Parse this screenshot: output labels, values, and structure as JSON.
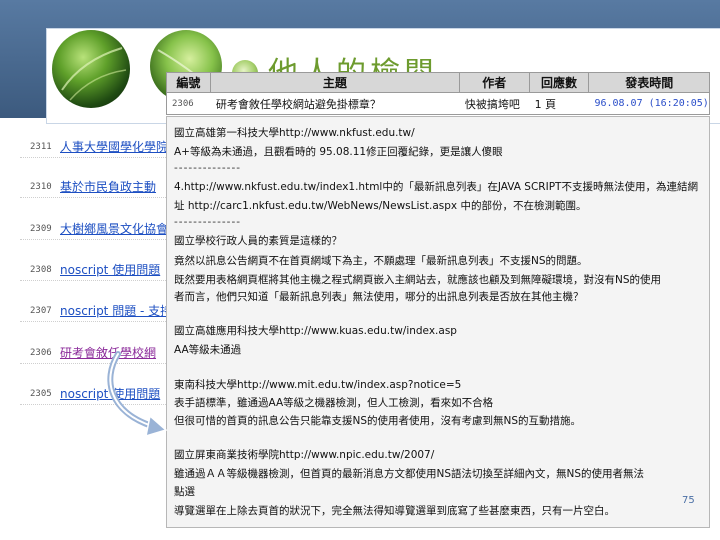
{
  "slide": {
    "title": "他人的檢閱",
    "page_number": "75"
  },
  "table": {
    "headers": [
      "編號",
      "主題",
      "作者",
      "回應數",
      "發表時間"
    ],
    "row": {
      "id": "2306",
      "subject": "研考會敘任學校網站避免掛標章？",
      "author": "快被搞垮吧",
      "replies": "1 頁",
      "time": "96.08.07 (16:20:05)"
    }
  },
  "background_list": [
    {
      "id": "2311",
      "title": "人事大學國學化學院",
      "visited": false
    },
    {
      "id": "2310",
      "title": "基於市民負政主動",
      "visited": false
    },
    {
      "id": "2309",
      "title": "大樹鄉風景文化協會",
      "visited": false
    },
    {
      "id": "2308",
      "title": "noscript 使用問題",
      "visited": false
    },
    {
      "id": "2307",
      "title": "noscript 問題 - 支持",
      "visited": false
    },
    {
      "id": "2306",
      "title": "研考會敘任學校網",
      "visited": true
    },
    {
      "id": "2305",
      "title": "noscript 使用問題",
      "visited": false
    }
  ],
  "post": {
    "lines": [
      "國立高雄第一科技大學http://www.nkfust.edu.tw/",
      "A+等級為未通過，且觀看時的 95.08.11修正回覆紀錄，更是讓人傻眼",
      "--------------",
      "4.http://www.nkfust.edu.tw/index1.html中的「最新訊息列表」在JAVA SCRIPT不支援時無法使用，為連結網",
      "址 http://carc1.nkfust.edu.tw/WebNews/NewsList.aspx 中的部份，不在檢測範圍。",
      "--------------",
      "國立學校行政人員的素質是這樣的？",
      "竟然以訊息公告網頁不在首頁網域下為主，不願處理「最新訊息列表」不支援NS的問題。",
      "既然要用表格網頁框將其他主機之程式網頁嵌入主網站去，就應該也顧及到無障礙環境，對沒有NS的使用",
      "者而言，他們只知道「最新訊息列表」無法使用，哪分的出訊息列表是否放在其他主機？",
      "國立高雄應用科技大學http://www.kuas.edu.tw/index.asp",
      "AA等級未通過",
      "東南科技大學http://www.mit.edu.tw/index.asp?notice=5",
      "表手語標準，雖通過AA等級之機器檢測，但人工檢測，看來如不合格",
      "但很可惜的首頁的訊息公告只能靠支援NS的使用者使用，沒有考慮到無NS的互動措施。",
      "國立屏東商業技術學院http://www.npic.edu.tw/2007/",
      "雖通過ＡＡ等級機器檢測，但首頁的最新消息方文都使用NS語法切換至詳細內文，無NS的使用者無法",
      "點選",
      "導覽選單在上除去頁首的狀況下，完全無法得知導覽選單到底寫了些甚麼東西，只有一片空白。"
    ]
  },
  "colors": {
    "header_band": "#3c5a7e",
    "title_green": "#6d9b2e",
    "link_blue": "#1d4fc2",
    "visited_purple": "#8b2a9a",
    "arrow_blue": "#9ab3d6"
  }
}
